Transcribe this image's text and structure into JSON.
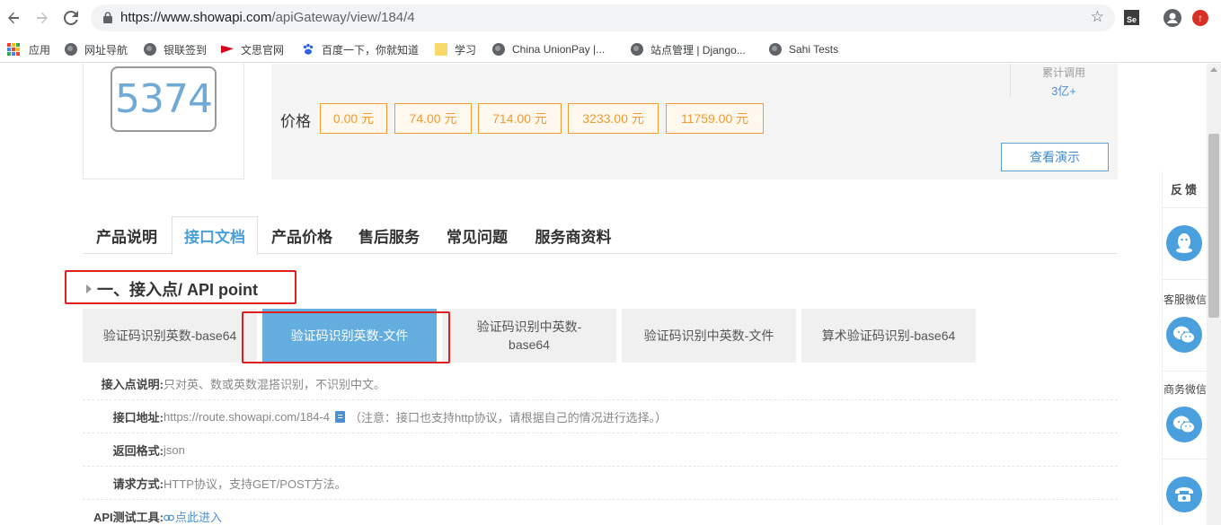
{
  "browser": {
    "url_host": "https://www.showapi.com",
    "url_path": "/apiGateway/view/184/4"
  },
  "bookmarks": [
    {
      "label": "应用"
    },
    {
      "label": "网址导航"
    },
    {
      "label": "银联签到"
    },
    {
      "label": "文思官网"
    },
    {
      "label": "百度一下，你就知道"
    },
    {
      "label": "学习"
    },
    {
      "label": "China UnionPay |..."
    },
    {
      "label": "站点管理 | Django..."
    },
    {
      "label": "Sahi Tests"
    }
  ],
  "product": {
    "logo_text": "5374",
    "cumulative_label": "累计调用",
    "cumulative_value": "3亿+",
    "price_label": "价格",
    "prices": [
      "0.00 元",
      "74.00 元",
      "714.00 元",
      "3233.00 元",
      "11759.00 元"
    ],
    "demo_button": "查看演示"
  },
  "tabs": [
    {
      "label": "产品说明",
      "active": false
    },
    {
      "label": "接口文档",
      "active": true
    },
    {
      "label": "产品价格",
      "active": false
    },
    {
      "label": "售后服务",
      "active": false
    },
    {
      "label": "常见问题",
      "active": false
    },
    {
      "label": "服务商资料",
      "active": false
    }
  ],
  "section": {
    "title": "一、接入点/ API point"
  },
  "endpoints": [
    {
      "label": "验证码识别英数-base64",
      "active": false
    },
    {
      "label": "验证码识别英数-文件",
      "active": true
    },
    {
      "label": "验证码识别中英数-base64",
      "active": false
    },
    {
      "label": "验证码识别中英数-文件",
      "active": false
    },
    {
      "label": "算术验证码识别-base64",
      "active": false
    }
  ],
  "info": {
    "desc_key": "接入点说明:",
    "desc_val": "只对英、数或英数混搭识别，不识别中文。",
    "addr_key": "接口地址:",
    "addr_val": "https://route.showapi.com/184-4",
    "addr_note": "（注意：接口也支持http协议，请根据自己的情况进行选择。）",
    "format_key": "返回格式:",
    "format_val": "json",
    "method_key": "请求方式:",
    "method_val": "HTTP协议，支持GET/POST方法。",
    "tool_key": "API测试工具:",
    "tool_val": "点此进入"
  },
  "side": {
    "feedback": "反馈",
    "service_wechat": "客服微信",
    "business_wechat": "商务微信"
  },
  "colors": {
    "accent": "#4a9fd8",
    "price_orange": "#f39a2c",
    "highlight_red": "#e02020",
    "active_card": "#64addf"
  }
}
